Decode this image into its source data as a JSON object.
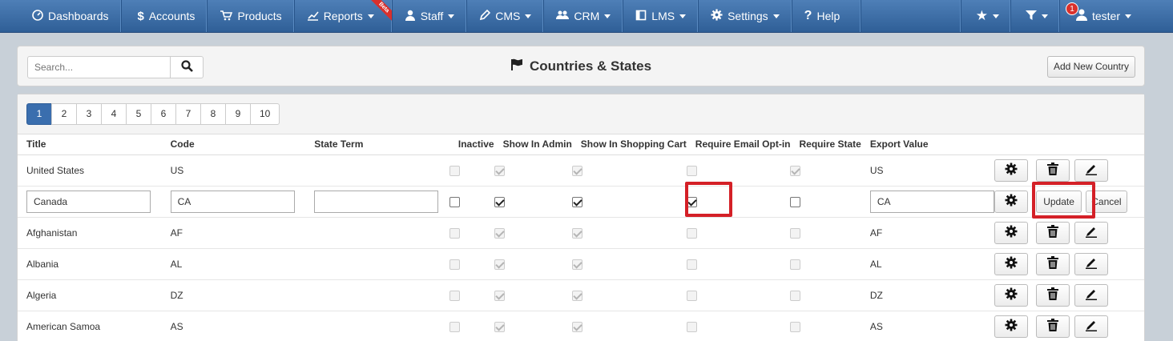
{
  "nav": {
    "items": [
      {
        "label": "Dashboards",
        "icon": "dashboard-icon",
        "caret": false
      },
      {
        "label": "Accounts",
        "icon": "dollar-icon",
        "caret": false
      },
      {
        "label": "Products",
        "icon": "cart-icon",
        "caret": false
      },
      {
        "label": "Reports",
        "icon": "chart-icon",
        "caret": true,
        "ribbon": "Beta"
      },
      {
        "label": "Staff",
        "icon": "user-icon",
        "caret": true
      },
      {
        "label": "CMS",
        "icon": "pencil-icon",
        "caret": true
      },
      {
        "label": "CRM",
        "icon": "users-icon",
        "caret": true
      },
      {
        "label": "LMS",
        "icon": "book-icon",
        "caret": true
      },
      {
        "label": "Settings",
        "icon": "gear-icon",
        "caret": true
      },
      {
        "label": "Help",
        "icon": "question-icon",
        "caret": false
      }
    ],
    "right": {
      "favorites_icon": "star-icon",
      "filter_icon": "filter-icon",
      "user_label": "tester",
      "notification_count": "1"
    }
  },
  "header": {
    "search_placeholder": "Search...",
    "title": "Countries & States",
    "add_button": "Add New Country"
  },
  "pagination": {
    "pages": [
      "1",
      "2",
      "3",
      "4",
      "5",
      "6",
      "7",
      "8",
      "9",
      "10"
    ],
    "active": "1"
  },
  "table": {
    "columns": [
      "Title",
      "Code",
      "State Term",
      "Inactive",
      "Show In Admin",
      "Show In Shopping Cart",
      "Require Email Opt-in",
      "Require State",
      "Export Value"
    ],
    "rows": [
      {
        "title": "United States",
        "code": "US",
        "state_term": "",
        "inactive": false,
        "show_admin": true,
        "show_cart": true,
        "email_optin": false,
        "require_state": true,
        "export": "US"
      },
      {
        "title": "Canada",
        "code": "CA",
        "state_term": "",
        "inactive": false,
        "show_admin": true,
        "show_cart": true,
        "email_optin": true,
        "require_state": false,
        "export": "CA",
        "editing": true
      },
      {
        "title": "Afghanistan",
        "code": "AF",
        "state_term": "",
        "inactive": false,
        "show_admin": true,
        "show_cart": true,
        "email_optin": false,
        "require_state": false,
        "export": "AF"
      },
      {
        "title": "Albania",
        "code": "AL",
        "state_term": "",
        "inactive": false,
        "show_admin": true,
        "show_cart": true,
        "email_optin": false,
        "require_state": false,
        "export": "AL"
      },
      {
        "title": "Algeria",
        "code": "DZ",
        "state_term": "",
        "inactive": false,
        "show_admin": true,
        "show_cart": true,
        "email_optin": false,
        "require_state": false,
        "export": "DZ"
      },
      {
        "title": "American Samoa",
        "code": "AS",
        "state_term": "",
        "inactive": false,
        "show_admin": true,
        "show_cart": true,
        "email_optin": false,
        "require_state": false,
        "export": "AS"
      }
    ],
    "edit_actions": {
      "update": "Update",
      "cancel": "Cancel"
    },
    "action_icons": [
      "gear-icon",
      "trash-icon",
      "pencil-icon"
    ]
  },
  "colors": {
    "nav_top": "#4e7fb7",
    "nav_bottom": "#2f5f97",
    "active_page": "#3a6eae",
    "highlight": "#d42027"
  }
}
